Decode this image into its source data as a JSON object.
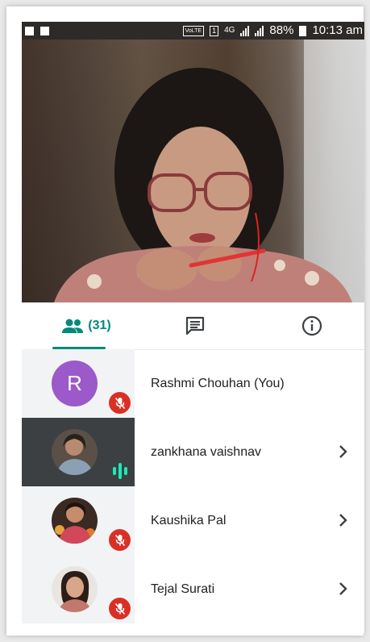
{
  "status_bar": {
    "network_badge": "VoLTE",
    "sim_label": "1",
    "net_type": "4G",
    "battery": "88%",
    "time": "10:13 am"
  },
  "tabs": {
    "people_count": "(31)",
    "active": "people"
  },
  "participants": [
    {
      "name": "Rashmi Chouhan (You)",
      "avatar_letter": "R",
      "avatar_color": "#9b59c9",
      "status": "muted",
      "has_chevron": false
    },
    {
      "name": "zankhana vaishnav",
      "status": "speaking",
      "has_chevron": true
    },
    {
      "name": "Kaushika Pal",
      "status": "muted",
      "has_chevron": true
    },
    {
      "name": "Tejal Surati",
      "status": "muted",
      "has_chevron": true
    }
  ],
  "colors": {
    "accent": "#00897b",
    "mute_red": "#d93025",
    "speaking_green": "#1de9b6"
  }
}
